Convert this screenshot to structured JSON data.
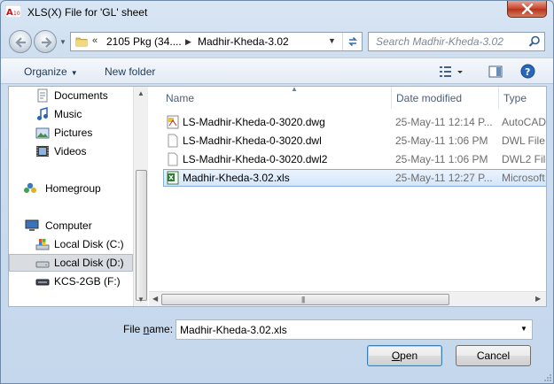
{
  "window": {
    "title": "XLS(X) File for 'GL' sheet"
  },
  "address": {
    "crumb_prefix": "«",
    "crumb_1": "2105 Pkg (34....",
    "crumb_2": "Madhir-Kheda-3.02"
  },
  "search": {
    "placeholder": "Search Madhir-Kheda-3.02"
  },
  "toolbar": {
    "organize_label": "Organize",
    "new_folder_label": "New folder"
  },
  "nav": {
    "items": [
      {
        "label": "Documents",
        "icon": "documents-icon"
      },
      {
        "label": "Music",
        "icon": "music-icon"
      },
      {
        "label": "Pictures",
        "icon": "pictures-icon"
      },
      {
        "label": "Videos",
        "icon": "videos-icon"
      },
      {
        "label": "Homegroup",
        "icon": "homegroup-icon"
      },
      {
        "label": "Computer",
        "icon": "computer-icon"
      },
      {
        "label": "Local Disk (C:)",
        "icon": "drive-c-icon"
      },
      {
        "label": "Local Disk (D:)",
        "icon": "drive-d-icon",
        "selected": true
      },
      {
        "label": "KCS-2GB (F:)",
        "icon": "usb-drive-icon"
      }
    ]
  },
  "columns": {
    "name": "Name",
    "date": "Date modified",
    "type": "Type"
  },
  "files": [
    {
      "name": "LS-Madhir-Kheda-0-3020.dwg",
      "date": "25-May-11 12:14 P...",
      "type": "AutoCAD",
      "icon": "autocad-file-icon"
    },
    {
      "name": "LS-Madhir-Kheda-0-3020.dwl",
      "date": "25-May-11 1:06 PM",
      "type": "DWL File",
      "icon": "blank-file-icon"
    },
    {
      "name": "LS-Madhir-Kheda-0-3020.dwl2",
      "date": "25-May-11 1:06 PM",
      "type": "DWL2 File",
      "icon": "blank-file-icon"
    },
    {
      "name": "Madhir-Kheda-3.02.xls",
      "date": "25-May-11 12:27 P...",
      "type": "Microsoft",
      "icon": "excel-file-icon",
      "selected": true
    }
  ],
  "footer": {
    "filename_label_pre": "File ",
    "filename_label_u": "n",
    "filename_label_post": "ame:",
    "filename_value": "Madhir-Kheda-3.02.xls",
    "open_u": "O",
    "open_rest": "pen",
    "cancel_label": "Cancel"
  },
  "colors": {
    "accent": "#3c7fb1",
    "selection": "#d4e6fb",
    "window_bg": "#cfdff0"
  }
}
